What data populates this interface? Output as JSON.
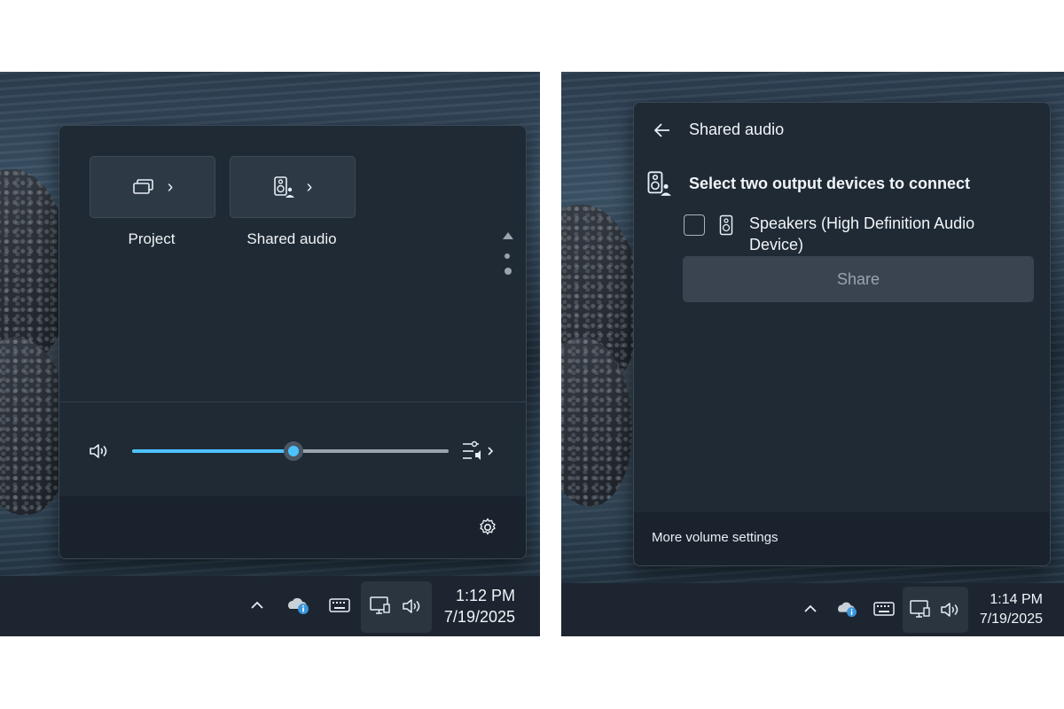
{
  "left": {
    "tiles": [
      {
        "label": "Project",
        "icon": "project-icon"
      },
      {
        "label": "Shared audio",
        "icon": "shared-audio-icon"
      }
    ],
    "volume": {
      "level_percent": 51,
      "accent": "#4cc2ff"
    },
    "taskbar": {
      "time": "1:12 PM",
      "date": "7/19/2025"
    }
  },
  "right": {
    "header": {
      "title": "Shared audio"
    },
    "section_title": "Select two output devices to connect",
    "devices": [
      {
        "name": "Speakers (High Definition Audio Device)",
        "checked": false,
        "icon": "speaker-icon"
      }
    ],
    "share_button": "Share",
    "footer_link": "More volume settings",
    "taskbar": {
      "time": "1:14 PM",
      "date": "7/19/2025"
    }
  }
}
